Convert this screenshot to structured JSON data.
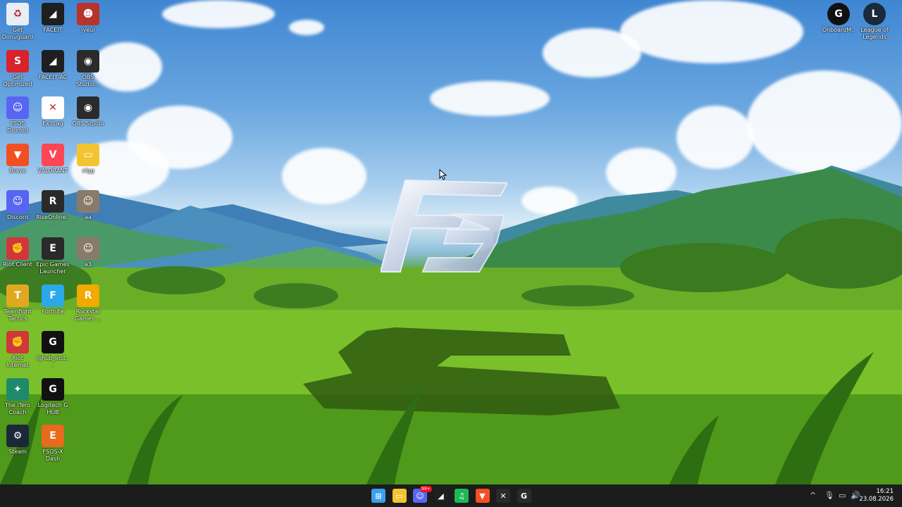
{
  "desktop": {
    "left_icons": [
      {
        "label": "Get Donuguard",
        "icon": "recycle-bin-icon",
        "color": "#e8eef5",
        "glyph": "♻",
        "col": 0,
        "row": 0
      },
      {
        "label": "FACEIT",
        "icon": "faceit-icon",
        "color": "#1f1f1f",
        "glyph": "◢",
        "col": 1,
        "row": 0
      },
      {
        "label": "jyeûi",
        "icon": "game-icon",
        "color": "#b8332a",
        "glyph": "☻",
        "col": 2,
        "row": 0
      },
      {
        "label": "Get Optimized",
        "icon": "fsos-icon",
        "color": "#d8232a",
        "glyph": "S",
        "col": 0,
        "row": 1
      },
      {
        "label": "FACEIT AC",
        "icon": "faceit-ac-icon",
        "color": "#1f1f1f",
        "glyph": "◢",
        "col": 1,
        "row": 1
      },
      {
        "label": "OBS Studio...",
        "icon": "obs-icon",
        "color": "#2b2b2b",
        "glyph": "◉",
        "col": 2,
        "row": 1
      },
      {
        "label": "FSOS Discord",
        "icon": "discord-icon",
        "color": "#5865f2",
        "glyph": "☺",
        "col": 0,
        "row": 2
      },
      {
        "label": "ExitLag",
        "icon": "exitlag-icon",
        "color": "#ffffff",
        "glyph": "✕",
        "col": 1,
        "row": 2
      },
      {
        "label": "OBS Studio",
        "icon": "obs-icon",
        "color": "#2b2b2b",
        "glyph": "◉",
        "col": 2,
        "row": 2
      },
      {
        "label": "Brave",
        "icon": "brave-icon",
        "color": "#f25022",
        "glyph": "▼",
        "col": 0,
        "row": 3
      },
      {
        "label": "VALORANT",
        "icon": "valorant-icon",
        "color": "#ff4655",
        "glyph": "V",
        "col": 1,
        "row": 3
      },
      {
        "label": "cfgg",
        "icon": "folder-icon",
        "color": "#f4c430",
        "glyph": "▭",
        "col": 2,
        "row": 3
      },
      {
        "label": "Discord",
        "icon": "discord-icon",
        "color": "#5865f2",
        "glyph": "☺",
        "col": 0,
        "row": 4
      },
      {
        "label": "RiseOnline...",
        "icon": "riseonline-icon",
        "color": "#2a2a2a",
        "glyph": "R",
        "col": 1,
        "row": 4
      },
      {
        "label": "aa",
        "icon": "image-file-icon",
        "color": "#8a7a6a",
        "glyph": "☺",
        "col": 2,
        "row": 4
      },
      {
        "label": "Riot Client",
        "icon": "riot-client-icon",
        "color": "#d13639",
        "glyph": "✊",
        "col": 0,
        "row": 5
      },
      {
        "label": "Epic Games Launcher",
        "icon": "epic-games-icon",
        "color": "#2a2a2a",
        "glyph": "E",
        "col": 1,
        "row": 5
      },
      {
        "label": "a3",
        "icon": "image-file-icon",
        "color": "#8a7a6a",
        "glyph": "☺",
        "col": 2,
        "row": 5
      },
      {
        "label": "Teamfight Tactics",
        "icon": "tft-icon",
        "color": "#e0a820",
        "glyph": "T",
        "col": 0,
        "row": 6
      },
      {
        "label": "Fortnite",
        "icon": "fortnite-icon",
        "color": "#2aa8e8",
        "glyph": "F",
        "col": 1,
        "row": 6
      },
      {
        "label": "Rockstar Games ...",
        "icon": "rockstar-icon",
        "color": "#f2a900",
        "glyph": "R",
        "col": 2,
        "row": 6
      },
      {
        "label": "Riot Internet",
        "icon": "riot-client-icon",
        "color": "#d13639",
        "glyph": "✊",
        "col": 0,
        "row": 7
      },
      {
        "label": "lghub_inst...",
        "icon": "logitech-icon",
        "color": "#111111",
        "glyph": "G",
        "col": 1,
        "row": 7
      },
      {
        "label": "The iTero Coach",
        "icon": "coach-icon",
        "color": "#1f8a6a",
        "glyph": "✦",
        "col": 0,
        "row": 8
      },
      {
        "label": "Logitech G HUB",
        "icon": "logitech-icon",
        "color": "#111111",
        "glyph": "G",
        "col": 1,
        "row": 8
      },
      {
        "label": "Steam",
        "icon": "steam-icon",
        "color": "#1b2838",
        "glyph": "⚙",
        "col": 0,
        "row": 9
      },
      {
        "label": "FSOS-X Dash",
        "icon": "fsos-dash-icon",
        "color": "#e86a1c",
        "glyph": "E",
        "col": 1,
        "row": 9
      }
    ],
    "right_icons": [
      {
        "label": "OnboardM...",
        "icon": "logitech-icon",
        "color": "#111111",
        "glyph": "G"
      },
      {
        "label": "League of Legends",
        "icon": "league-icon",
        "color": "#1a2a3a",
        "glyph": "L"
      }
    ]
  },
  "taskbar": {
    "pinned": [
      {
        "name": "start",
        "icon": "windows-icon",
        "color": "#3aa0f0",
        "glyph": "⊞"
      },
      {
        "name": "explorer",
        "icon": "folder-icon",
        "color": "#f4c430",
        "glyph": "▭"
      },
      {
        "name": "discord",
        "icon": "discord-icon",
        "color": "#5865f2",
        "glyph": "☺",
        "badge": "99+"
      },
      {
        "name": "faceit",
        "icon": "faceit-icon",
        "color": "#1f1f1f",
        "glyph": "◢"
      },
      {
        "name": "spotify",
        "icon": "spotify-icon",
        "color": "#1db954",
        "glyph": "♫"
      },
      {
        "name": "brave",
        "icon": "brave-icon",
        "color": "#f25022",
        "glyph": "▼"
      },
      {
        "name": "exitlag",
        "icon": "exitlag-icon",
        "color": "#2a2a2a",
        "glyph": "✕"
      },
      {
        "name": "ghub",
        "icon": "logitech-icon",
        "color": "#2a2a2a",
        "glyph": "G"
      }
    ],
    "tray": {
      "chevron": "^",
      "time": "16:21",
      "date": "23.08.2026"
    }
  }
}
